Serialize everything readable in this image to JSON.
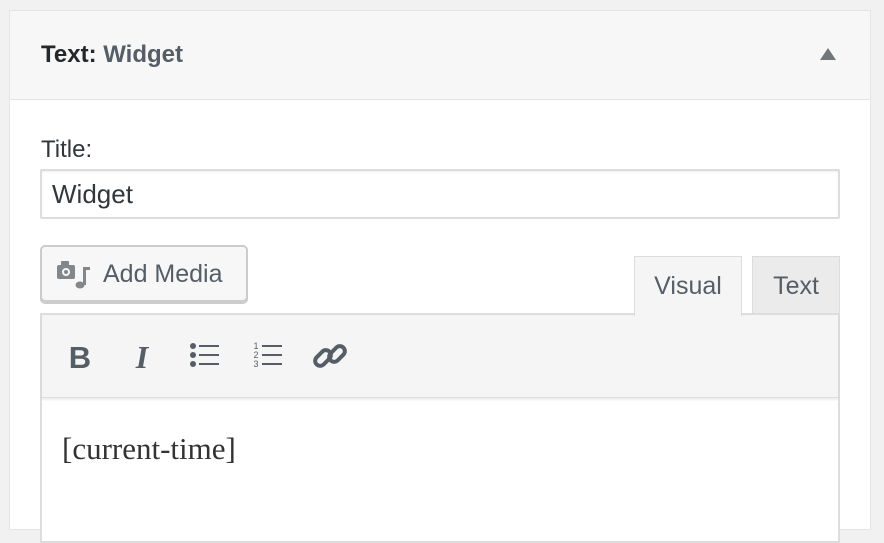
{
  "widget": {
    "title_label": "Text:",
    "title_value": "Widget",
    "toggle_icon": "arrow-up-icon"
  },
  "form": {
    "title_field_label": "Title:",
    "title_field_value": "Widget"
  },
  "media": {
    "add_media_label": "Add Media",
    "icon": "media-icon"
  },
  "tabs": [
    {
      "label": "Visual",
      "active": true
    },
    {
      "label": "Text",
      "active": false
    }
  ],
  "toolbar": {
    "buttons": [
      {
        "name": "bold",
        "icon": "bold-icon"
      },
      {
        "name": "italic",
        "icon": "italic-icon"
      },
      {
        "name": "bulleted-list",
        "icon": "bulleted-list-icon"
      },
      {
        "name": "numbered-list",
        "icon": "numbered-list-icon"
      },
      {
        "name": "link",
        "icon": "link-icon"
      }
    ]
  },
  "editor": {
    "content": "[current-time]"
  },
  "colors": {
    "header_bg": "#f7f7f7",
    "icon": "#555d66",
    "text": "#32373c"
  }
}
